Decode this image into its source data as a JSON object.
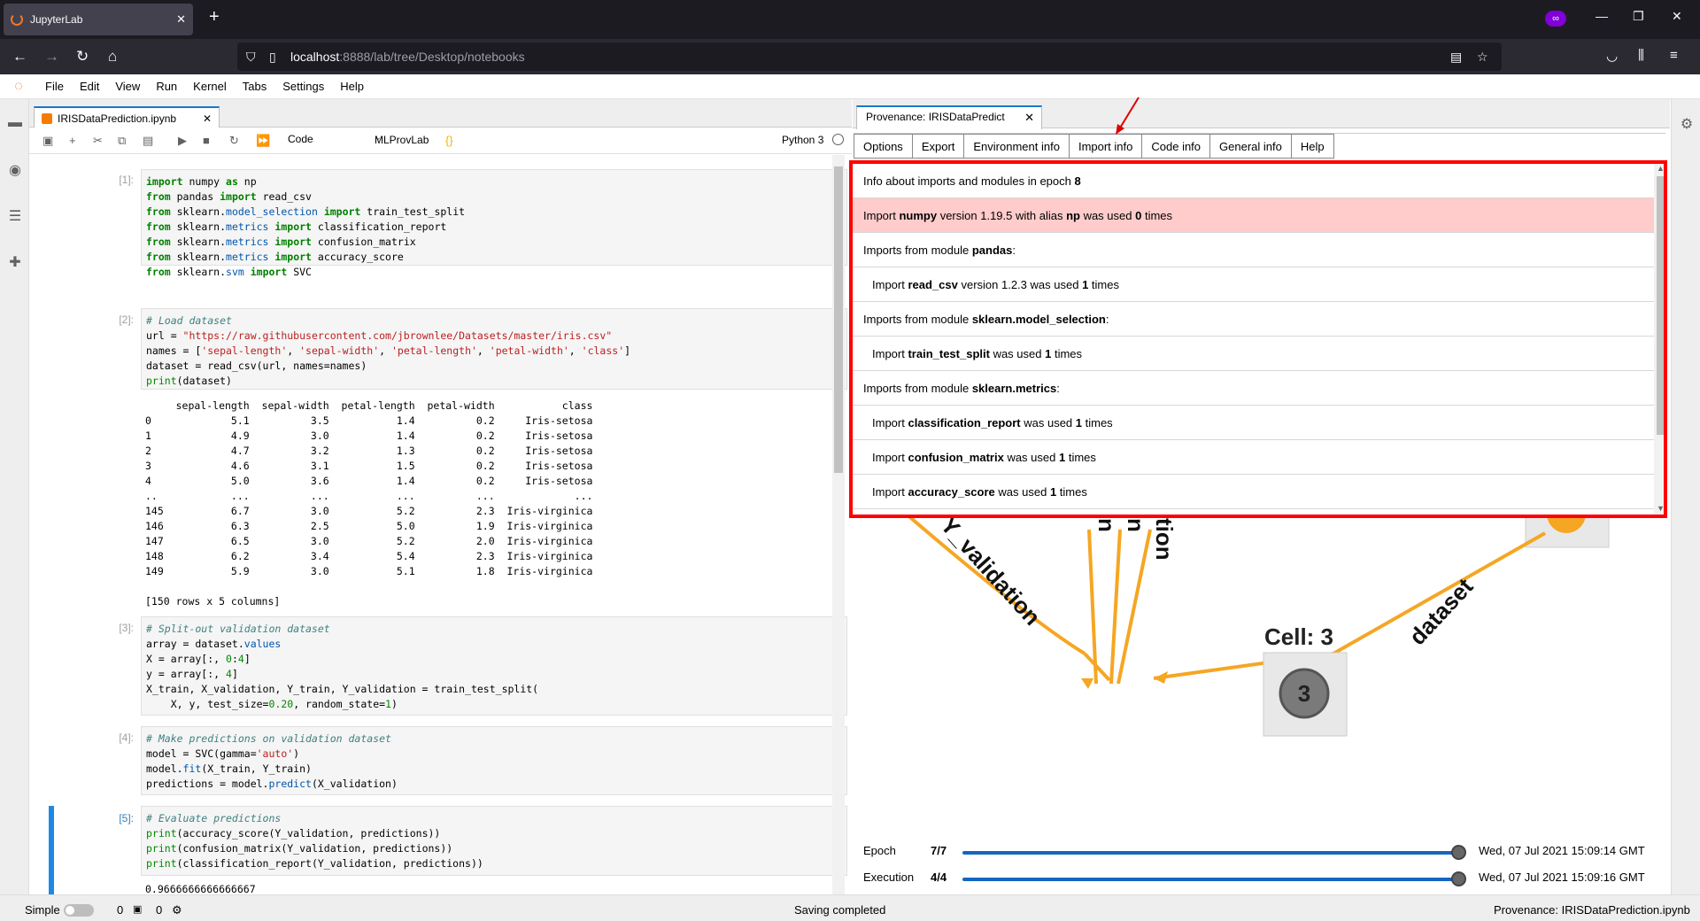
{
  "browser": {
    "tab_title": "JupyterLab",
    "url_host": "localhost",
    "url_rest": ":8888/lab/tree/Desktop/notebooks"
  },
  "menu": [
    "File",
    "Edit",
    "View",
    "Run",
    "Kernel",
    "Tabs",
    "Settings",
    "Help"
  ],
  "notebook": {
    "tab_title": "IRISDataPrediction.ipynb",
    "cell_type": "Code",
    "extension": "MLProvLab",
    "kernel": "Python 3",
    "cells": [
      {
        "prompt": "[1]:"
      },
      {
        "prompt": "[2]:"
      },
      {
        "prompt": "[3]:"
      },
      {
        "prompt": "[4]:"
      },
      {
        "prompt": "[5]:"
      }
    ],
    "output2": "     sepal-length  sepal-width  petal-length  petal-width           class\n0             5.1          3.5           1.4          0.2     Iris-setosa\n1             4.9          3.0           1.4          0.2     Iris-setosa\n2             4.7          3.2           1.3          0.2     Iris-setosa\n3             4.6          3.1           1.5          0.2     Iris-setosa\n4             5.0          3.6           1.4          0.2     Iris-setosa\n..            ...          ...           ...          ...             ...\n145           6.7          3.0           5.2          2.3  Iris-virginica\n146           6.3          2.5           5.0          1.9  Iris-virginica\n147           6.5          3.0           5.2          2.0  Iris-virginica\n148           6.2          3.4           5.4          2.3  Iris-virginica\n149           5.9          3.0           5.1          1.8  Iris-virginica\n\n[150 rows x 5 columns]",
    "output5": "0.9666666666666667"
  },
  "provenance": {
    "tab_title": "Provenance: IRISDataPredict",
    "nav": [
      "Options",
      "Export",
      "Environment info",
      "Import info",
      "Code info",
      "General info",
      "Help"
    ],
    "popup": {
      "header_text": "Info about imports and modules in epoch ",
      "header_epoch": "8",
      "rows": [
        {
          "pre": "Import ",
          "b1": "numpy",
          "mid": " version 1.19.5 with alias ",
          "b2": "np",
          "mid2": " was used ",
          "b3": "0",
          "post": " times",
          "sub": false,
          "hl": true
        },
        {
          "pre": "Imports from module ",
          "b1": "pandas",
          "mid": ":",
          "b2": "",
          "mid2": "",
          "b3": "",
          "post": "",
          "sub": false,
          "hl": false
        },
        {
          "pre": "Import ",
          "b1": "read_csv",
          "mid": " version 1.2.3 was used ",
          "b2": "1",
          "mid2": " times",
          "b3": "",
          "post": "",
          "sub": true,
          "hl": false
        },
        {
          "pre": "Imports from module ",
          "b1": "sklearn.model_selection",
          "mid": ":",
          "b2": "",
          "mid2": "",
          "b3": "",
          "post": "",
          "sub": false,
          "hl": false
        },
        {
          "pre": "Import ",
          "b1": "train_test_split",
          "mid": " was used ",
          "b2": "1",
          "mid2": " times",
          "b3": "",
          "post": "",
          "sub": true,
          "hl": false
        },
        {
          "pre": "Imports from module ",
          "b1": "sklearn.metrics",
          "mid": ":",
          "b2": "",
          "mid2": "",
          "b3": "",
          "post": "",
          "sub": false,
          "hl": false
        },
        {
          "pre": "Import ",
          "b1": "classification_report",
          "mid": " was used ",
          "b2": "1",
          "mid2": " times",
          "b3": "",
          "post": "",
          "sub": true,
          "hl": false
        },
        {
          "pre": "Import ",
          "b1": "confusion_matrix",
          "mid": " was used ",
          "b2": "1",
          "mid2": " times",
          "b3": "",
          "post": "",
          "sub": true,
          "hl": false
        },
        {
          "pre": "Import ",
          "b1": "accuracy_score",
          "mid": " was used ",
          "b2": "1",
          "mid2": " times",
          "b3": "",
          "post": "",
          "sub": true,
          "hl": false
        }
      ]
    },
    "graph": {
      "cell_label": "Cell: 3",
      "node": "3",
      "edge_validation": "Y_validation",
      "edge_dataset": "dataset",
      "edge_tion": "tion",
      "edge_n1": "n",
      "edge_n2": "n"
    },
    "epoch_label": "Epoch",
    "epoch_value": "7/7",
    "epoch_date": "Wed, 07 Jul 2021 15:09:14 GMT",
    "execution_label": "Execution",
    "execution_value": "4/4",
    "execution_date": "Wed, 07 Jul 2021 15:09:16 GMT"
  },
  "status": {
    "mode": "Simple",
    "count1": "0",
    "count2": "0",
    "message": "Saving completed",
    "right": "Provenance: IRISDataPrediction.ipynb"
  },
  "colors": {
    "accent": "#1976d2",
    "highlight": "#ffcccb",
    "popup_border": "#ff0000",
    "graph_edge": "#f5a623",
    "jupyter_orange": "#f37626"
  }
}
